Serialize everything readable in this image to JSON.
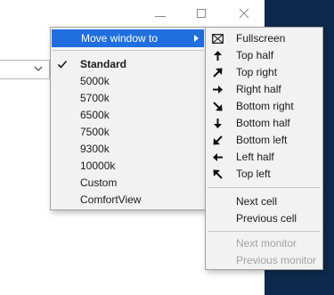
{
  "main_menu": {
    "items": [
      {
        "label": "Move window to",
        "has_submenu": true,
        "highlighted": true
      },
      {
        "label": "Standard",
        "checked": true,
        "bold": true
      },
      {
        "label": "5000k"
      },
      {
        "label": "5700k"
      },
      {
        "label": "6500k"
      },
      {
        "label": "7500k"
      },
      {
        "label": "9300k"
      },
      {
        "label": "10000k"
      },
      {
        "label": "Custom"
      },
      {
        "label": "ComfortView"
      }
    ]
  },
  "submenu": {
    "items": [
      {
        "label": "Fullscreen",
        "icon": "fullscreen-icon"
      },
      {
        "label": "Top half",
        "icon": "arrow-up-icon"
      },
      {
        "label": "Top right",
        "icon": "arrow-up-right-icon"
      },
      {
        "label": "Right half",
        "icon": "arrow-right-icon"
      },
      {
        "label": "Bottom right",
        "icon": "arrow-down-right-icon"
      },
      {
        "label": "Bottom half",
        "icon": "arrow-down-icon"
      },
      {
        "label": "Bottom left",
        "icon": "arrow-down-left-icon"
      },
      {
        "label": "Left half",
        "icon": "arrow-left-icon"
      },
      {
        "label": "Top left",
        "icon": "arrow-up-left-icon"
      },
      {
        "label": "Next cell"
      },
      {
        "label": "Previous cell"
      },
      {
        "label": "Next monitor",
        "disabled": true
      },
      {
        "label": "Previous monitor",
        "disabled": true
      }
    ]
  },
  "colors": {
    "highlight": "#1f6fe0",
    "menu_bg": "#f2f2f2",
    "dark_panel": "#0d2a4c",
    "disabled_text": "#a3a3a3"
  }
}
